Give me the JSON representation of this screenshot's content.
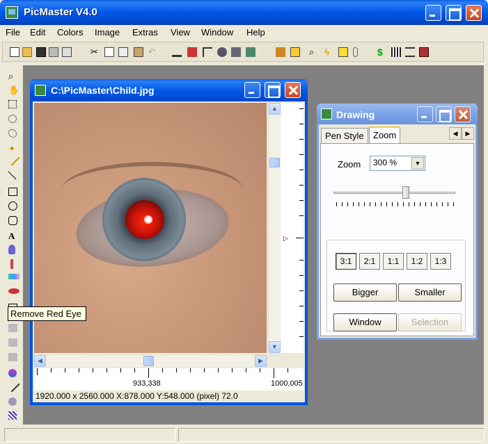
{
  "app": {
    "title": "PicMaster V4.0"
  },
  "menu": [
    "File",
    "Edit",
    "Colors",
    "Image",
    "Extras",
    "View",
    "Window",
    "Help"
  ],
  "toolbar_icons": [
    "new-icon",
    "open-icon",
    "save-icon",
    "scan-icon",
    "print-icon",
    "cut-icon",
    "paste-special-icon",
    "copy-icon",
    "paste-icon",
    "undo-icon",
    "flip-icon",
    "crop-icon",
    "redeye-tool-icon",
    "filter-icon",
    "camera-icon",
    "effects-icon",
    "stamp-icon",
    "clipboard-icon",
    "zoom-icon",
    "lightning-icon",
    "select-icon",
    "pin-icon",
    "dollar-icon",
    "qr-icon",
    "list-icon",
    "book-icon"
  ],
  "tools": [
    "zoom-tool-icon",
    "hand-tool-icon",
    "rect-select-icon",
    "ellipse-select-icon",
    "lasso-icon",
    "magic-wand-icon",
    "pencil-icon",
    "line-icon",
    "rectangle-icon",
    "ellipse-icon",
    "rounded-rect-icon",
    "text-tool-icon",
    "paint-bucket-icon",
    "brush-icon",
    "gradient-icon",
    "remove-red-eye-icon",
    "clone-tool-icon",
    "shape-1-icon",
    "shape-2-icon",
    "shape-3-icon",
    "shape-4-icon",
    "color-pick-icon",
    "dropper-icon",
    "spray-icon",
    "pattern-icon"
  ],
  "tooltip": "Remove Red Eye",
  "image_window": {
    "title": "C:\\PicMaster\\Child.jpg",
    "ruler_labels": [
      "933,338",
      "1000,005"
    ],
    "status": "1920.000 x 2560.000    X:878.000  Y:548.000 (pixel)  72.0"
  },
  "drawing_panel": {
    "title": "Drawing",
    "tabs": [
      "Pen Style",
      "Zoom"
    ],
    "active_tab": "Zoom",
    "zoom_label": "Zoom",
    "zoom_value": "300 %",
    "ratios": [
      "3:1",
      "2:1",
      "1:1",
      "1:2",
      "1:3"
    ],
    "active_ratio": "3:1",
    "bigger": "Bigger",
    "smaller": "Smaller",
    "window": "Window",
    "selection": "Selection"
  },
  "colors": {
    "xp_blue": "#0054e3",
    "inactive_title": "#7aa3e8",
    "red_eye": "#d0140a"
  }
}
